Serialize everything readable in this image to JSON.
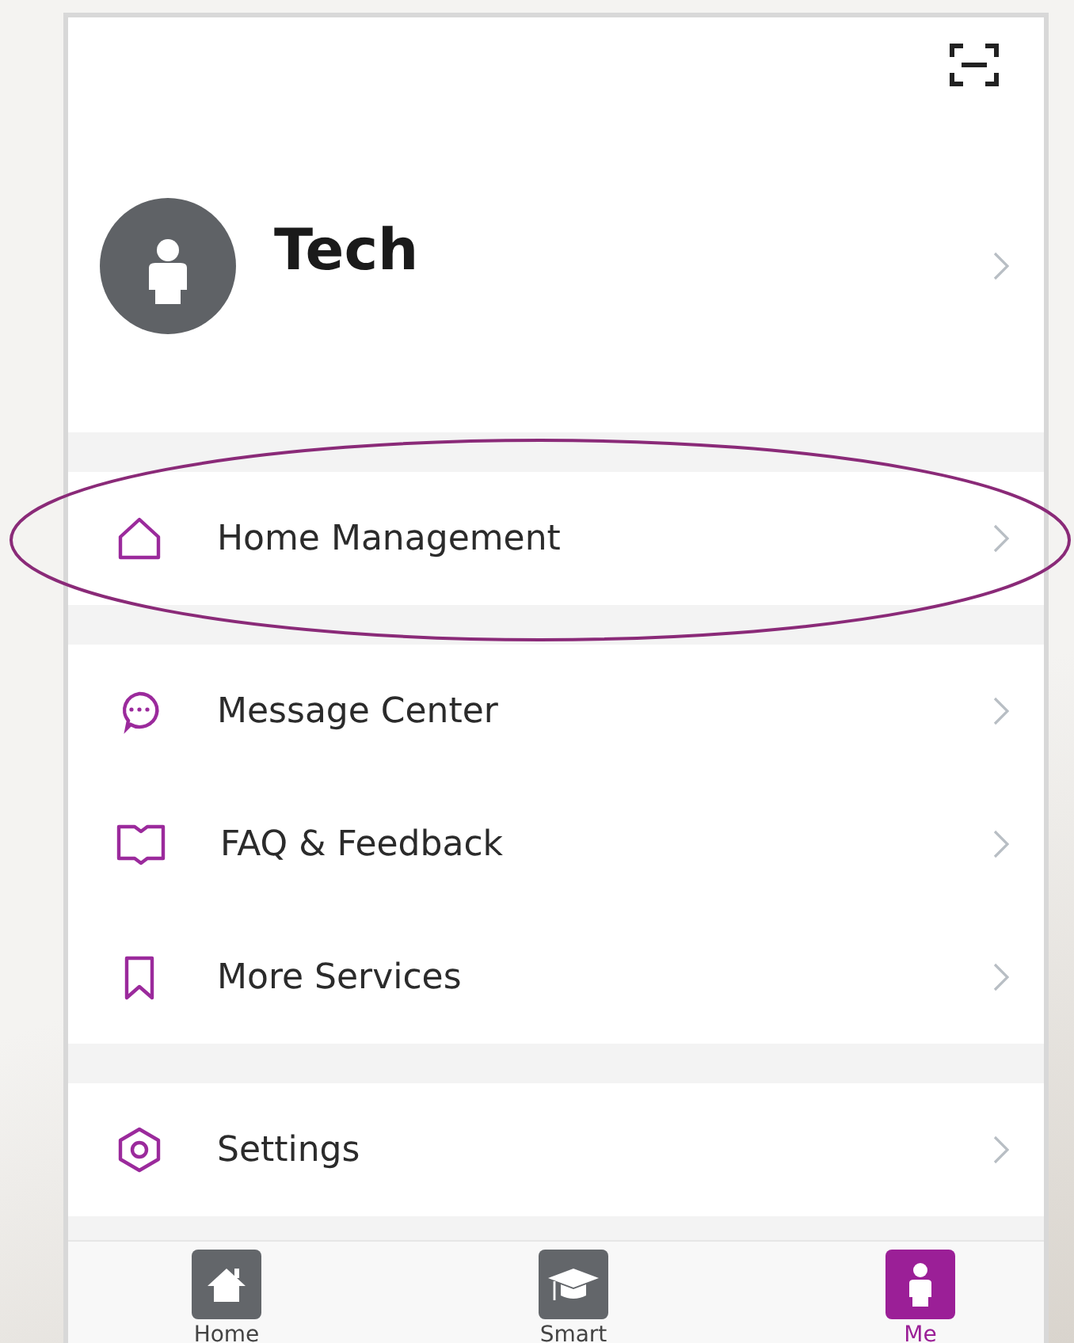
{
  "profile": {
    "name": "Tech"
  },
  "sections": [
    {
      "items": [
        {
          "kind": "home",
          "label": "Home Management",
          "highlighted": true
        }
      ]
    },
    {
      "items": [
        {
          "kind": "message",
          "label": "Message Center",
          "highlighted": false
        },
        {
          "kind": "book",
          "label": "FAQ & Feedback",
          "highlighted": false
        },
        {
          "kind": "bookmark",
          "label": "More Services",
          "highlighted": false
        }
      ]
    },
    {
      "items": [
        {
          "kind": "settings",
          "label": "Settings",
          "highlighted": false
        }
      ]
    }
  ],
  "tabs": [
    {
      "kind": "home",
      "label": "Home",
      "selected": false
    },
    {
      "kind": "smart",
      "label": "Smart",
      "selected": false
    },
    {
      "kind": "me",
      "label": "Me",
      "selected": true
    }
  ]
}
